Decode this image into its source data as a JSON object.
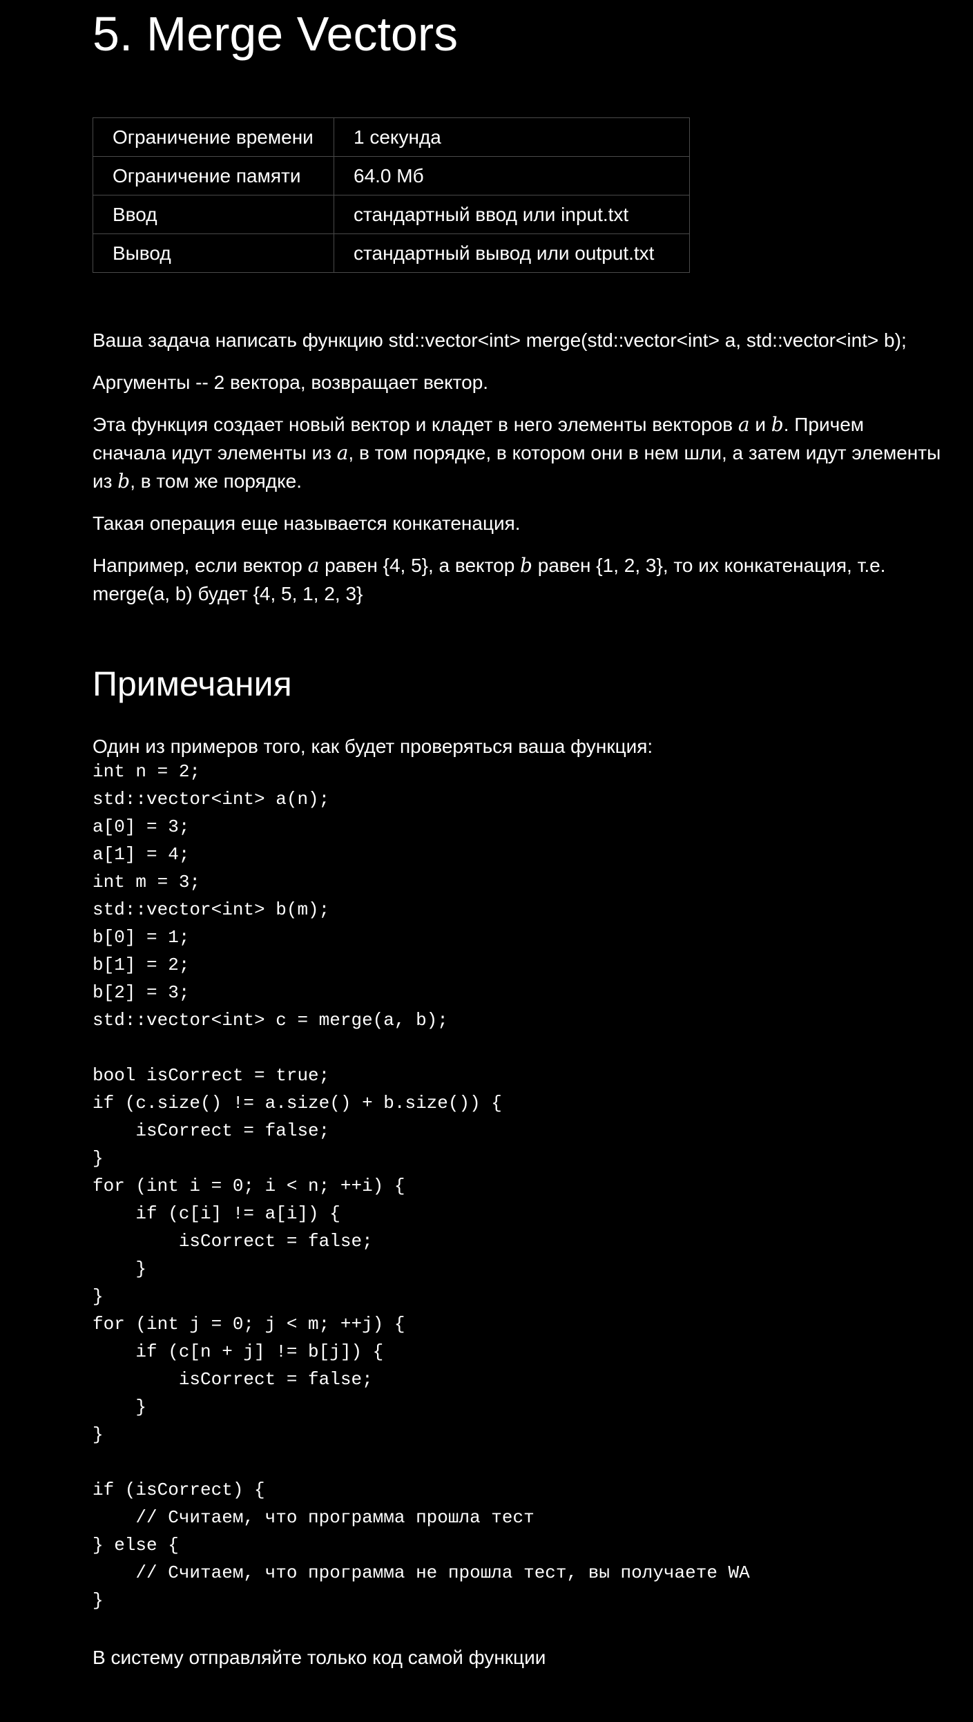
{
  "problem": {
    "title": "5. Merge Vectors"
  },
  "limits": [
    {
      "label": "Ограничение времени",
      "value": "1 секунда"
    },
    {
      "label": "Ограничение памяти",
      "value": "64.0 Мб"
    },
    {
      "label": "Ввод",
      "value": "стандартный ввод или input.txt"
    },
    {
      "label": "Вывод",
      "value": "стандартный вывод или output.txt"
    }
  ],
  "statement": {
    "p1": "Ваша задача написать функцию std::vector<int> merge(std::vector<int> a, std::vector<int> b);",
    "p2": "Аргументы -- 2 вектора, возвращает вектор.",
    "p3": {
      "t1": "Эта функция создает новый вектор и кладет в него элементы векторов ",
      "m1": "a",
      "t2": " и ",
      "m2": "b",
      "t3": ". Причем сначала идут элементы из ",
      "m3": "a",
      "t4": ", в том порядке, в котором они в нем шли, а затем идут элементы из ",
      "m4": "b",
      "t5": ", в том же порядке."
    },
    "p4": "Такая операция еще называется конкатенация.",
    "p5": {
      "t1": "Например, если вектор ",
      "m1": "a",
      "t2": " равен {4, 5}, а вектор ",
      "m2": "b",
      "t3": " равен {1, 2, 3}, то их конкатенация, т.е. merge(a, b) будет {4, 5, 1, 2, 3}"
    }
  },
  "notes": {
    "title": "Примечания",
    "intro": "Один из примеров того, как будет проверяться ваша функция:",
    "code": [
      "int n = 2;",
      "std::vector<int> a(n);",
      "a[0] = 3;",
      "a[1] = 4;",
      "int m = 3;",
      "std::vector<int> b(m);",
      "b[0] = 1;",
      "b[1] = 2;",
      "b[2] = 3;",
      "std::vector<int> c = merge(a, b);",
      "",
      "bool isCorrect = true;",
      "if (c.size() != a.size() + b.size()) {",
      "    isCorrect = false;",
      "}",
      "for (int i = 0; i < n; ++i) {",
      "    if (c[i] != a[i]) {",
      "        isCorrect = false;",
      "    }",
      "}",
      "for (int j = 0; j < m; ++j) {",
      "    if (c[n + j] != b[j]) {",
      "        isCorrect = false;",
      "    }",
      "}",
      "",
      "if (isCorrect) {",
      "    // Считаем, что программа прошла тест",
      "} else {",
      "    // Считаем, что программа не прошла тест, вы получаете WA",
      "}"
    ],
    "footer": "В систему отправляйте только код самой функции"
  }
}
